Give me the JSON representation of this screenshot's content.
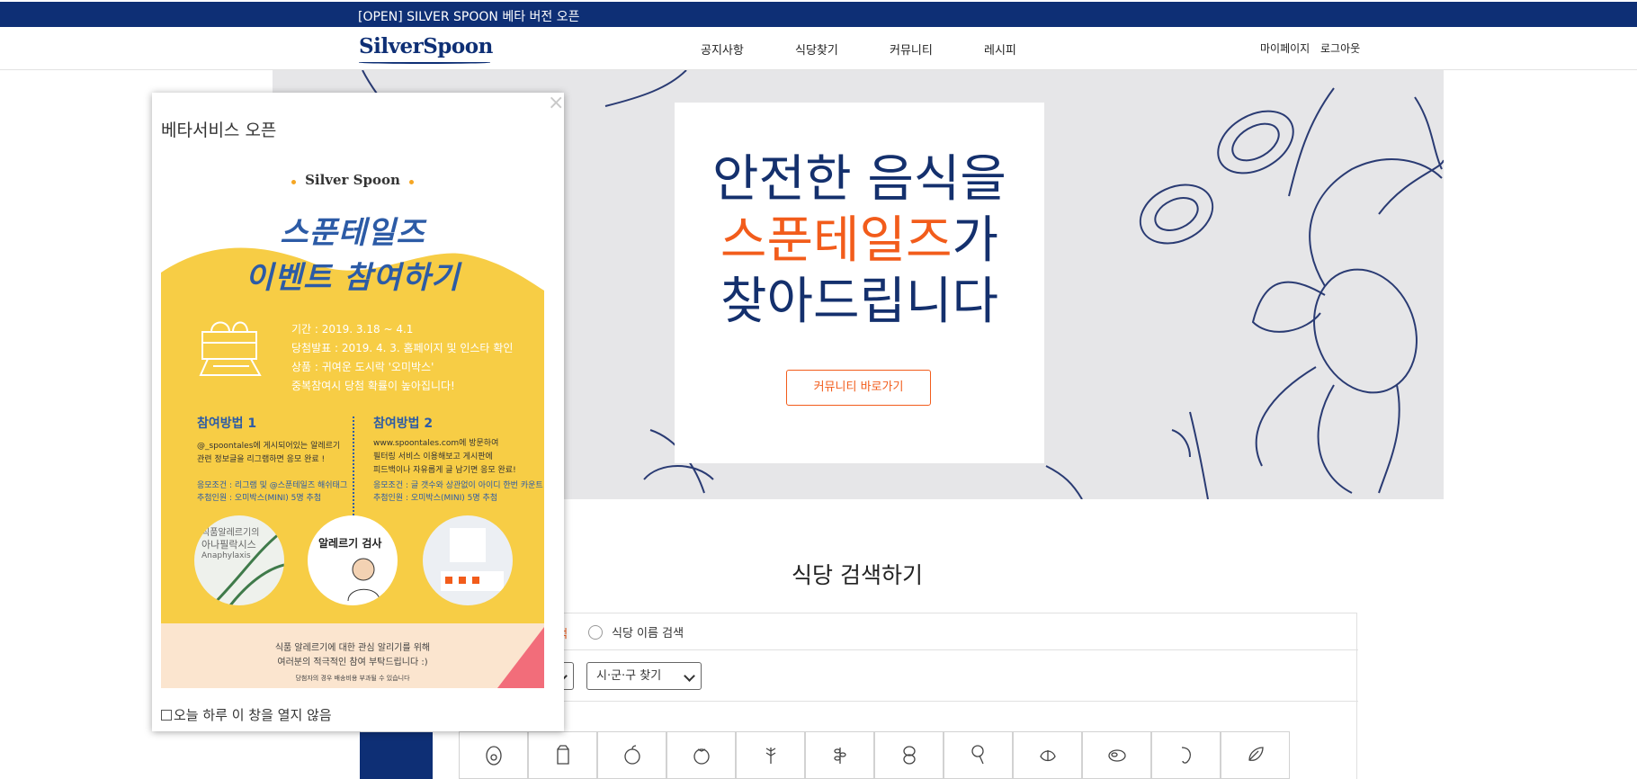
{
  "topbar": {
    "text": "[OPEN] SILVER SPOON 베타 버전 오픈"
  },
  "header": {
    "logo": "SilverSpoon",
    "nav": [
      "공지사항",
      "식당찾기",
      "커뮤니티",
      "레시피"
    ],
    "util": [
      "마이페이지",
      "로그아웃"
    ]
  },
  "hero": {
    "line1": "안전한 음식을",
    "line2_accent": "스푼테일즈",
    "line2_rest": "가",
    "line3": "찾아드립니다",
    "button": "커뮤니티 바로가기"
  },
  "search": {
    "title": "식당 검색하기",
    "radio_accent_fragment": "색",
    "radio_name_label": "식당 이름 검색",
    "select_city": "시·군·구 찾기",
    "categories": [
      "",
      "",
      "",
      "",
      "",
      "",
      "",
      "",
      "",
      "",
      "",
      ""
    ]
  },
  "popup": {
    "title": "베타서비스 오픈",
    "close": "×",
    "checkbox_label": "오늘 하루 이 창을 열지 않음",
    "poster": {
      "brand": "Silver Spoon",
      "headline1": "스푼테일즈",
      "headline2": "이벤트 참여하기",
      "period": "기간 : 2019. 3.18 ~ 4.1",
      "announce": "당첨발표 : 2019. 4. 3. 홈페이지 및 인스타 확인",
      "prize": "상품 : 귀여운 도시락 '오미박스'",
      "note": "중복참여시 당첨 확률이 높아집니다!",
      "method1_title": "참여방법 1",
      "method1_line1": "@_spoontales에 게시되어있는 알레르기",
      "method1_line2": "관련 정보글을 리그램하면 응모 완료 !",
      "method1_cond": "응모조건 : 리그램 및 @스푼테일즈 해쉬태그",
      "method1_prize": "추첨인원 : 오미박스(MINI) 5명 추첨",
      "method2_title": "참여방법 2",
      "method2_line1": "www.spoontales.com에 방문하여",
      "method2_line2": "필터링 서비스 이용해보고 게시판에",
      "method2_line3": "피드백이나 자유롭게 글 남기면 응모 완료!",
      "method2_cond": "응모조건 : 글 갯수와 상관없이 아이디 한번 카운트",
      "method2_prize": "추첨인원 : 오미박스(MINI) 5명 추첨",
      "circle1_text": "식품알레르기의",
      "circle1_text2": "아나필락시스",
      "circle1_text3": "Anaphylaxis",
      "circle2_text": "알레르기 검사",
      "bottom1": "식품 알레르기에 대한 관심 알리기를 위해",
      "bottom2": "여러분의 적극적인 참여 부탁드립니다 :)",
      "bottom3": "당첨자의 경우 배송비용 부과될 수 있습니다"
    }
  }
}
